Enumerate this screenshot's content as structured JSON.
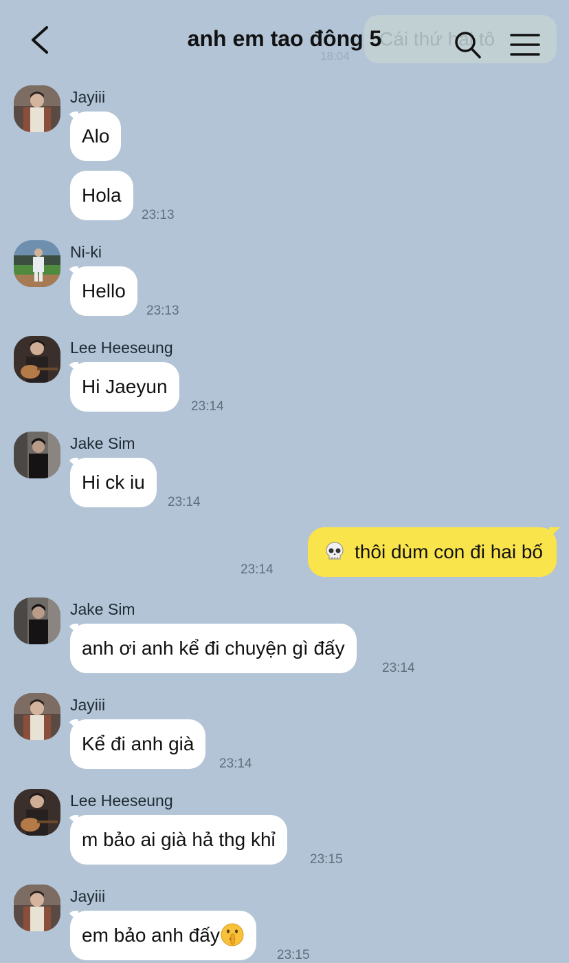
{
  "header": {
    "title": "anh em tao đông 5",
    "ghost_message": "Cái thứ hai tô",
    "ghost_time": "18:04"
  },
  "messages": [
    {
      "sender": "Jayiii",
      "bubbles": [
        "Alo",
        "Hola"
      ],
      "time": "23:13"
    },
    {
      "sender": "Ni-ki",
      "bubbles": [
        "Hello"
      ],
      "time": "23:13"
    },
    {
      "sender": "Lee Heeseung",
      "bubbles": [
        "Hi Jaeyun"
      ],
      "time": "23:14"
    },
    {
      "sender": "Jake Sim",
      "bubbles": [
        "Hi ck iu"
      ],
      "time": "23:14"
    },
    {
      "sender": "me",
      "bubbles": [
        "thôi dùm con đi hai bố"
      ],
      "time": "23:14"
    },
    {
      "sender": "Jake Sim",
      "bubbles": [
        "anh ơi anh kể đi chuyện gì đấy"
      ],
      "time": "23:14"
    },
    {
      "sender": "Jayiii",
      "bubbles": [
        "Kể đi anh già"
      ],
      "time": "23:14"
    },
    {
      "sender": "Lee Heeseung",
      "bubbles": [
        "m bảo ai già hả thg khỉ"
      ],
      "time": "23:15"
    },
    {
      "sender": "Jayiii",
      "bubbles": [
        "em bảo anh đấy"
      ],
      "time": "23:15"
    }
  ],
  "icons": {
    "back": "back-chevron-icon",
    "search": "search-icon",
    "menu": "menu-icon",
    "skull": "skull-emoji",
    "shush": "shushing-face-emoji"
  },
  "colors": {
    "background": "#b2c4d6",
    "incoming_bubble": "#ffffff",
    "outgoing_bubble": "#fae44c"
  }
}
